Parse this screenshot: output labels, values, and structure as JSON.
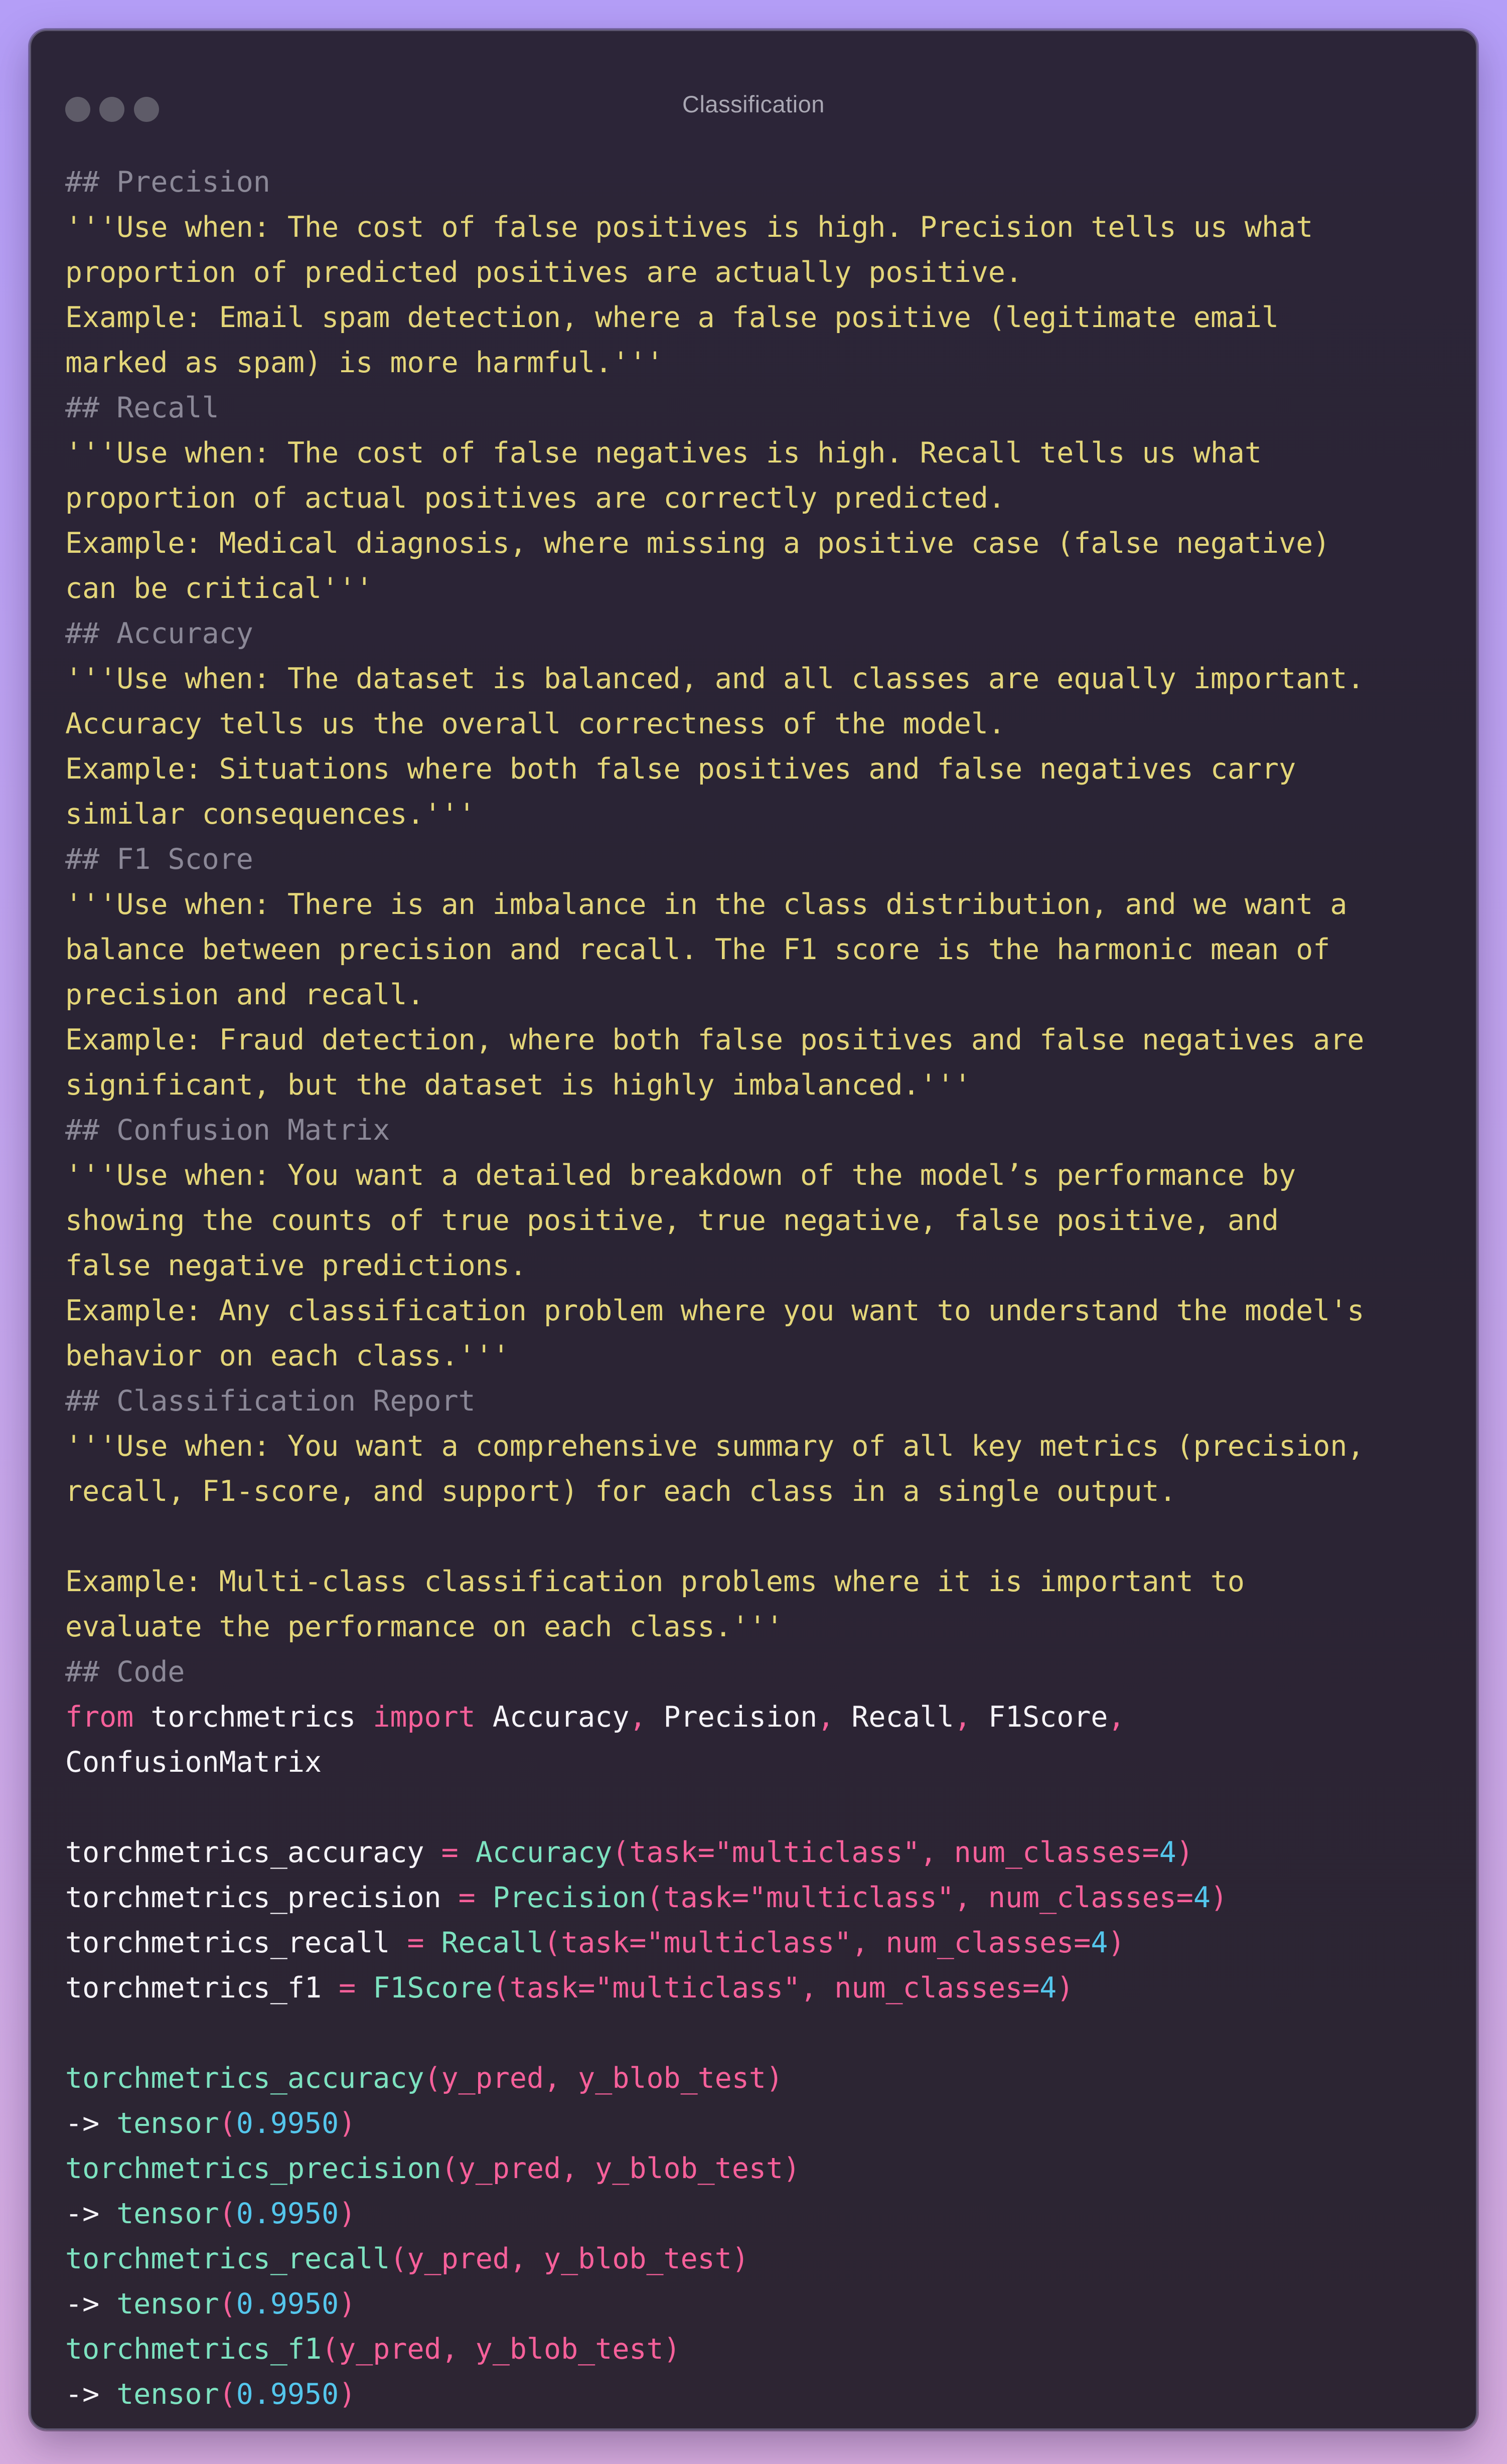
{
  "window": {
    "title": "Classification"
  },
  "code_lines": [
    [
      {
        "t": "## Precision",
        "c": "comment"
      }
    ],
    [
      {
        "t": "'''Use when: The cost of false positives is high. Precision tells us what",
        "c": "string"
      }
    ],
    [
      {
        "t": "proportion of predicted positives are actually positive.",
        "c": "string"
      }
    ],
    [
      {
        "t": "Example: Email spam detection, where a false positive (legitimate email",
        "c": "string"
      }
    ],
    [
      {
        "t": "marked as spam) is more harmful.'''",
        "c": "string"
      }
    ],
    [
      {
        "t": "## Recall",
        "c": "comment"
      }
    ],
    [
      {
        "t": "'''Use when: The cost of false negatives is high. Recall tells us what",
        "c": "string"
      }
    ],
    [
      {
        "t": "proportion of actual positives are correctly predicted.",
        "c": "string"
      }
    ],
    [
      {
        "t": "Example: Medical diagnosis, where missing a positive case (false negative)",
        "c": "string"
      }
    ],
    [
      {
        "t": "can be critical'''",
        "c": "string"
      }
    ],
    [
      {
        "t": "## Accuracy",
        "c": "comment"
      }
    ],
    [
      {
        "t": "'''Use when: The dataset is balanced, and all classes are equally important.",
        "c": "string"
      }
    ],
    [
      {
        "t": "Accuracy tells us the overall correctness of the model.",
        "c": "string"
      }
    ],
    [
      {
        "t": "Example: Situations where both false positives and false negatives carry",
        "c": "string"
      }
    ],
    [
      {
        "t": "similar consequences.'''",
        "c": "string"
      }
    ],
    [
      {
        "t": "## F1 Score",
        "c": "comment"
      }
    ],
    [
      {
        "t": "'''Use when: There is an imbalance in the class distribution, and we want a",
        "c": "string"
      }
    ],
    [
      {
        "t": "balance between precision and recall. The F1 score is the harmonic mean of",
        "c": "string"
      }
    ],
    [
      {
        "t": "precision and recall.",
        "c": "string"
      }
    ],
    [
      {
        "t": "Example: Fraud detection, where both false positives and false negatives are",
        "c": "string"
      }
    ],
    [
      {
        "t": "significant, but the dataset is highly imbalanced.'''",
        "c": "string"
      }
    ],
    [
      {
        "t": "## Confusion Matrix",
        "c": "comment"
      }
    ],
    [
      {
        "t": "'''Use when: You want a detailed breakdown of the model’s performance by",
        "c": "string"
      }
    ],
    [
      {
        "t": "showing the counts of true positive, true negative, false positive, and",
        "c": "string"
      }
    ],
    [
      {
        "t": "false negative predictions.",
        "c": "string"
      }
    ],
    [
      {
        "t": "Example: Any classification problem where you want to understand the model's",
        "c": "string"
      }
    ],
    [
      {
        "t": "behavior on each class.'''",
        "c": "string"
      }
    ],
    [
      {
        "t": "## Classification Report",
        "c": "comment"
      }
    ],
    [
      {
        "t": "'''Use when: You want a comprehensive summary of all key metrics (precision,",
        "c": "string"
      }
    ],
    [
      {
        "t": "recall, F1-score, and support) for each class in a single output.",
        "c": "string"
      }
    ],
    [],
    [
      {
        "t": "Example: Multi-class classification problems where it is important to",
        "c": "string"
      }
    ],
    [
      {
        "t": "evaluate the performance on each class.'''",
        "c": "string"
      }
    ],
    [
      {
        "t": "## Code",
        "c": "comment"
      }
    ],
    [
      {
        "t": "from",
        "c": "kw"
      },
      {
        "t": " torchmetrics ",
        "c": "ident"
      },
      {
        "t": "import",
        "c": "kw"
      },
      {
        "t": " Accuracy",
        "c": "ident"
      },
      {
        "t": ",",
        "c": "punct"
      },
      {
        "t": " Precision",
        "c": "ident"
      },
      {
        "t": ",",
        "c": "punct"
      },
      {
        "t": " Recall",
        "c": "ident"
      },
      {
        "t": ",",
        "c": "punct"
      },
      {
        "t": " F1Score",
        "c": "ident"
      },
      {
        "t": ",",
        "c": "punct"
      }
    ],
    [
      {
        "t": "ConfusionMatrix",
        "c": "ident"
      }
    ],
    [],
    [
      {
        "t": "torchmetrics_accuracy ",
        "c": "ident"
      },
      {
        "t": "=",
        "c": "punct"
      },
      {
        "t": " Accuracy",
        "c": "fn"
      },
      {
        "t": "(task=\"multiclass\", num_classes=",
        "c": "kw"
      },
      {
        "t": "4",
        "c": "num"
      },
      {
        "t": ")",
        "c": "kw"
      }
    ],
    [
      {
        "t": "torchmetrics_precision ",
        "c": "ident"
      },
      {
        "t": "=",
        "c": "punct"
      },
      {
        "t": " Precision",
        "c": "fn"
      },
      {
        "t": "(task=\"multiclass\", num_classes=",
        "c": "kw"
      },
      {
        "t": "4",
        "c": "num"
      },
      {
        "t": ")",
        "c": "kw"
      }
    ],
    [
      {
        "t": "torchmetrics_recall ",
        "c": "ident"
      },
      {
        "t": "=",
        "c": "punct"
      },
      {
        "t": " Recall",
        "c": "fn"
      },
      {
        "t": "(task=\"multiclass\", num_classes=",
        "c": "kw"
      },
      {
        "t": "4",
        "c": "num"
      },
      {
        "t": ")",
        "c": "kw"
      }
    ],
    [
      {
        "t": "torchmetrics_f1 ",
        "c": "ident"
      },
      {
        "t": "=",
        "c": "punct"
      },
      {
        "t": " F1Score",
        "c": "fn"
      },
      {
        "t": "(task=\"multiclass\", num_classes=",
        "c": "kw"
      },
      {
        "t": "4",
        "c": "num"
      },
      {
        "t": ")",
        "c": "kw"
      }
    ],
    [],
    [
      {
        "t": "torchmetrics_accuracy",
        "c": "fn"
      },
      {
        "t": "(y_pred, y_blob_test)",
        "c": "kw"
      }
    ],
    [
      {
        "t": "->",
        "c": "ident"
      },
      {
        "t": " tensor",
        "c": "fn"
      },
      {
        "t": "(",
        "c": "kw"
      },
      {
        "t": "0.9950",
        "c": "num"
      },
      {
        "t": ")",
        "c": "kw"
      }
    ],
    [
      {
        "t": "torchmetrics_precision",
        "c": "fn"
      },
      {
        "t": "(y_pred, y_blob_test)",
        "c": "kw"
      }
    ],
    [
      {
        "t": "->",
        "c": "ident"
      },
      {
        "t": " tensor",
        "c": "fn"
      },
      {
        "t": "(",
        "c": "kw"
      },
      {
        "t": "0.9950",
        "c": "num"
      },
      {
        "t": ")",
        "c": "kw"
      }
    ],
    [
      {
        "t": "torchmetrics_recall",
        "c": "fn"
      },
      {
        "t": "(y_pred, y_blob_test)",
        "c": "kw"
      }
    ],
    [
      {
        "t": "->",
        "c": "ident"
      },
      {
        "t": " tensor",
        "c": "fn"
      },
      {
        "t": "(",
        "c": "kw"
      },
      {
        "t": "0.9950",
        "c": "num"
      },
      {
        "t": ")",
        "c": "kw"
      }
    ],
    [
      {
        "t": "torchmetrics_f1",
        "c": "fn"
      },
      {
        "t": "(y_pred, y_blob_test)",
        "c": "kw"
      }
    ],
    [
      {
        "t": "->",
        "c": "ident"
      },
      {
        "t": " tensor",
        "c": "fn"
      },
      {
        "t": "(",
        "c": "kw"
      },
      {
        "t": "0.9950",
        "c": "num"
      },
      {
        "t": ")",
        "c": "kw"
      }
    ]
  ]
}
